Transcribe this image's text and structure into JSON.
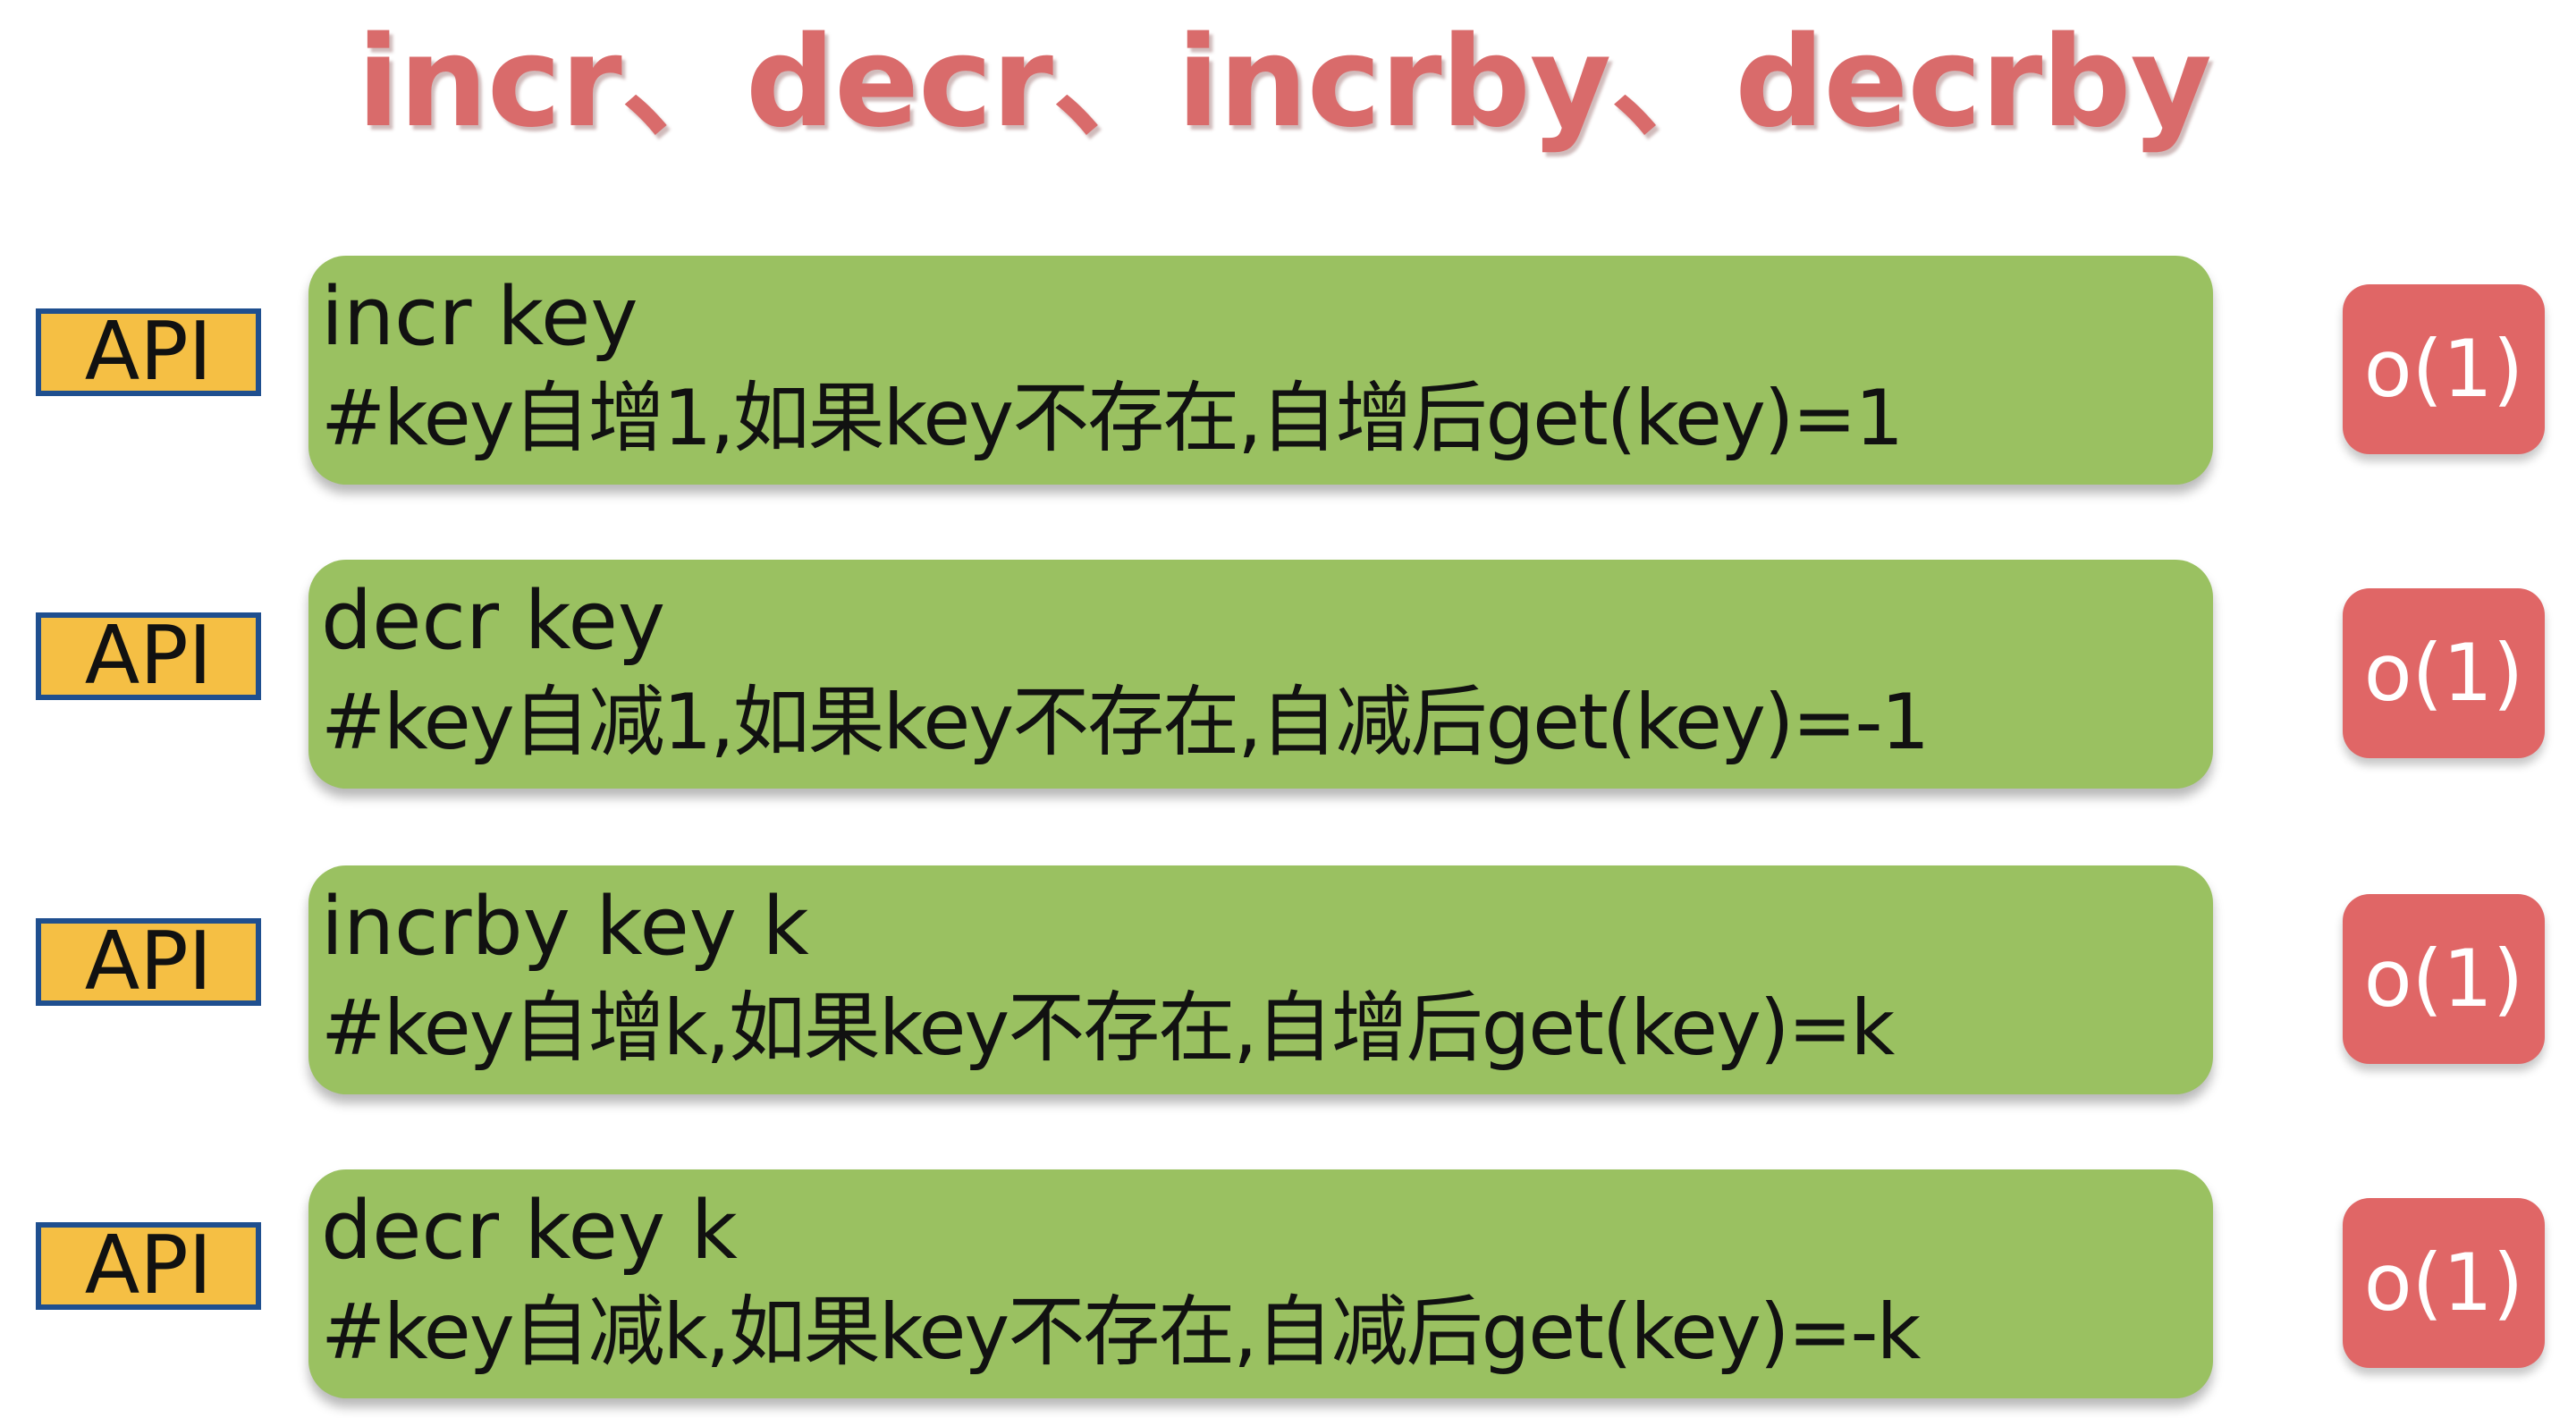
{
  "title": "incr、decr、incrby、decrby",
  "commands": [
    {
      "api_label": "API",
      "command": "incr key",
      "description": "#key自增1,如果key不存在,自增后get(key)=1",
      "complexity": "o(1)"
    },
    {
      "api_label": "API",
      "command": "decr key",
      "description": "#key自减1,如果key不存在,自减后get(key)=-1",
      "complexity": "o(1)"
    },
    {
      "api_label": "API",
      "command": "incrby key k",
      "description": "#key自增k,如果key不存在,自增后get(key)=k",
      "complexity": "o(1)"
    },
    {
      "api_label": "API",
      "command": "decr key k",
      "description": "#key自减k,如果key不存在,自减后get(key)=-k",
      "complexity": "o(1)"
    }
  ],
  "colors": {
    "title": "#d96b6b",
    "api_fill": "#f5bf44",
    "api_border": "#1f4f8f",
    "command_box": "#9ac161",
    "complexity_badge": "#e06666"
  }
}
